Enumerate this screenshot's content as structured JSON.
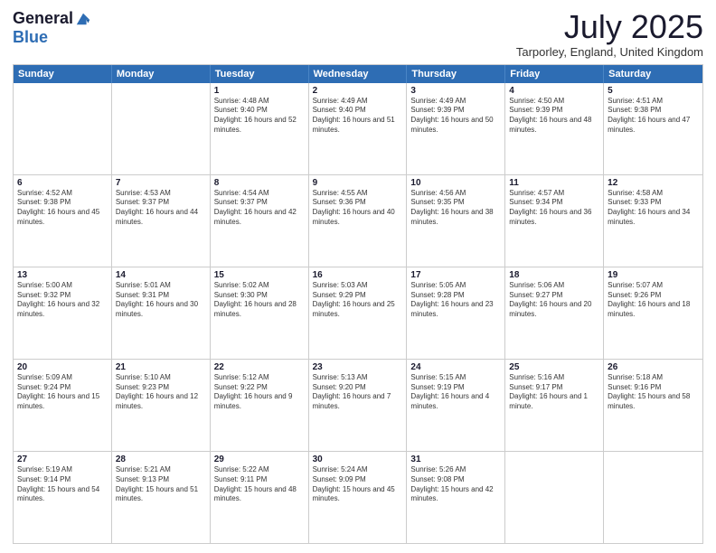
{
  "logo": {
    "general": "General",
    "blue": "Blue"
  },
  "title": "July 2025",
  "subtitle": "Tarporley, England, United Kingdom",
  "header_days": [
    "Sunday",
    "Monday",
    "Tuesday",
    "Wednesday",
    "Thursday",
    "Friday",
    "Saturday"
  ],
  "rows": [
    [
      {
        "day": "",
        "sunrise": "",
        "sunset": "",
        "daylight": ""
      },
      {
        "day": "",
        "sunrise": "",
        "sunset": "",
        "daylight": ""
      },
      {
        "day": "1",
        "sunrise": "Sunrise: 4:48 AM",
        "sunset": "Sunset: 9:40 PM",
        "daylight": "Daylight: 16 hours and 52 minutes."
      },
      {
        "day": "2",
        "sunrise": "Sunrise: 4:49 AM",
        "sunset": "Sunset: 9:40 PM",
        "daylight": "Daylight: 16 hours and 51 minutes."
      },
      {
        "day": "3",
        "sunrise": "Sunrise: 4:49 AM",
        "sunset": "Sunset: 9:39 PM",
        "daylight": "Daylight: 16 hours and 50 minutes."
      },
      {
        "day": "4",
        "sunrise": "Sunrise: 4:50 AM",
        "sunset": "Sunset: 9:39 PM",
        "daylight": "Daylight: 16 hours and 48 minutes."
      },
      {
        "day": "5",
        "sunrise": "Sunrise: 4:51 AM",
        "sunset": "Sunset: 9:38 PM",
        "daylight": "Daylight: 16 hours and 47 minutes."
      }
    ],
    [
      {
        "day": "6",
        "sunrise": "Sunrise: 4:52 AM",
        "sunset": "Sunset: 9:38 PM",
        "daylight": "Daylight: 16 hours and 45 minutes."
      },
      {
        "day": "7",
        "sunrise": "Sunrise: 4:53 AM",
        "sunset": "Sunset: 9:37 PM",
        "daylight": "Daylight: 16 hours and 44 minutes."
      },
      {
        "day": "8",
        "sunrise": "Sunrise: 4:54 AM",
        "sunset": "Sunset: 9:37 PM",
        "daylight": "Daylight: 16 hours and 42 minutes."
      },
      {
        "day": "9",
        "sunrise": "Sunrise: 4:55 AM",
        "sunset": "Sunset: 9:36 PM",
        "daylight": "Daylight: 16 hours and 40 minutes."
      },
      {
        "day": "10",
        "sunrise": "Sunrise: 4:56 AM",
        "sunset": "Sunset: 9:35 PM",
        "daylight": "Daylight: 16 hours and 38 minutes."
      },
      {
        "day": "11",
        "sunrise": "Sunrise: 4:57 AM",
        "sunset": "Sunset: 9:34 PM",
        "daylight": "Daylight: 16 hours and 36 minutes."
      },
      {
        "day": "12",
        "sunrise": "Sunrise: 4:58 AM",
        "sunset": "Sunset: 9:33 PM",
        "daylight": "Daylight: 16 hours and 34 minutes."
      }
    ],
    [
      {
        "day": "13",
        "sunrise": "Sunrise: 5:00 AM",
        "sunset": "Sunset: 9:32 PM",
        "daylight": "Daylight: 16 hours and 32 minutes."
      },
      {
        "day": "14",
        "sunrise": "Sunrise: 5:01 AM",
        "sunset": "Sunset: 9:31 PM",
        "daylight": "Daylight: 16 hours and 30 minutes."
      },
      {
        "day": "15",
        "sunrise": "Sunrise: 5:02 AM",
        "sunset": "Sunset: 9:30 PM",
        "daylight": "Daylight: 16 hours and 28 minutes."
      },
      {
        "day": "16",
        "sunrise": "Sunrise: 5:03 AM",
        "sunset": "Sunset: 9:29 PM",
        "daylight": "Daylight: 16 hours and 25 minutes."
      },
      {
        "day": "17",
        "sunrise": "Sunrise: 5:05 AM",
        "sunset": "Sunset: 9:28 PM",
        "daylight": "Daylight: 16 hours and 23 minutes."
      },
      {
        "day": "18",
        "sunrise": "Sunrise: 5:06 AM",
        "sunset": "Sunset: 9:27 PM",
        "daylight": "Daylight: 16 hours and 20 minutes."
      },
      {
        "day": "19",
        "sunrise": "Sunrise: 5:07 AM",
        "sunset": "Sunset: 9:26 PM",
        "daylight": "Daylight: 16 hours and 18 minutes."
      }
    ],
    [
      {
        "day": "20",
        "sunrise": "Sunrise: 5:09 AM",
        "sunset": "Sunset: 9:24 PM",
        "daylight": "Daylight: 16 hours and 15 minutes."
      },
      {
        "day": "21",
        "sunrise": "Sunrise: 5:10 AM",
        "sunset": "Sunset: 9:23 PM",
        "daylight": "Daylight: 16 hours and 12 minutes."
      },
      {
        "day": "22",
        "sunrise": "Sunrise: 5:12 AM",
        "sunset": "Sunset: 9:22 PM",
        "daylight": "Daylight: 16 hours and 9 minutes."
      },
      {
        "day": "23",
        "sunrise": "Sunrise: 5:13 AM",
        "sunset": "Sunset: 9:20 PM",
        "daylight": "Daylight: 16 hours and 7 minutes."
      },
      {
        "day": "24",
        "sunrise": "Sunrise: 5:15 AM",
        "sunset": "Sunset: 9:19 PM",
        "daylight": "Daylight: 16 hours and 4 minutes."
      },
      {
        "day": "25",
        "sunrise": "Sunrise: 5:16 AM",
        "sunset": "Sunset: 9:17 PM",
        "daylight": "Daylight: 16 hours and 1 minute."
      },
      {
        "day": "26",
        "sunrise": "Sunrise: 5:18 AM",
        "sunset": "Sunset: 9:16 PM",
        "daylight": "Daylight: 15 hours and 58 minutes."
      }
    ],
    [
      {
        "day": "27",
        "sunrise": "Sunrise: 5:19 AM",
        "sunset": "Sunset: 9:14 PM",
        "daylight": "Daylight: 15 hours and 54 minutes."
      },
      {
        "day": "28",
        "sunrise": "Sunrise: 5:21 AM",
        "sunset": "Sunset: 9:13 PM",
        "daylight": "Daylight: 15 hours and 51 minutes."
      },
      {
        "day": "29",
        "sunrise": "Sunrise: 5:22 AM",
        "sunset": "Sunset: 9:11 PM",
        "daylight": "Daylight: 15 hours and 48 minutes."
      },
      {
        "day": "30",
        "sunrise": "Sunrise: 5:24 AM",
        "sunset": "Sunset: 9:09 PM",
        "daylight": "Daylight: 15 hours and 45 minutes."
      },
      {
        "day": "31",
        "sunrise": "Sunrise: 5:26 AM",
        "sunset": "Sunset: 9:08 PM",
        "daylight": "Daylight: 15 hours and 42 minutes."
      },
      {
        "day": "",
        "sunrise": "",
        "sunset": "",
        "daylight": ""
      },
      {
        "day": "",
        "sunrise": "",
        "sunset": "",
        "daylight": ""
      }
    ]
  ]
}
